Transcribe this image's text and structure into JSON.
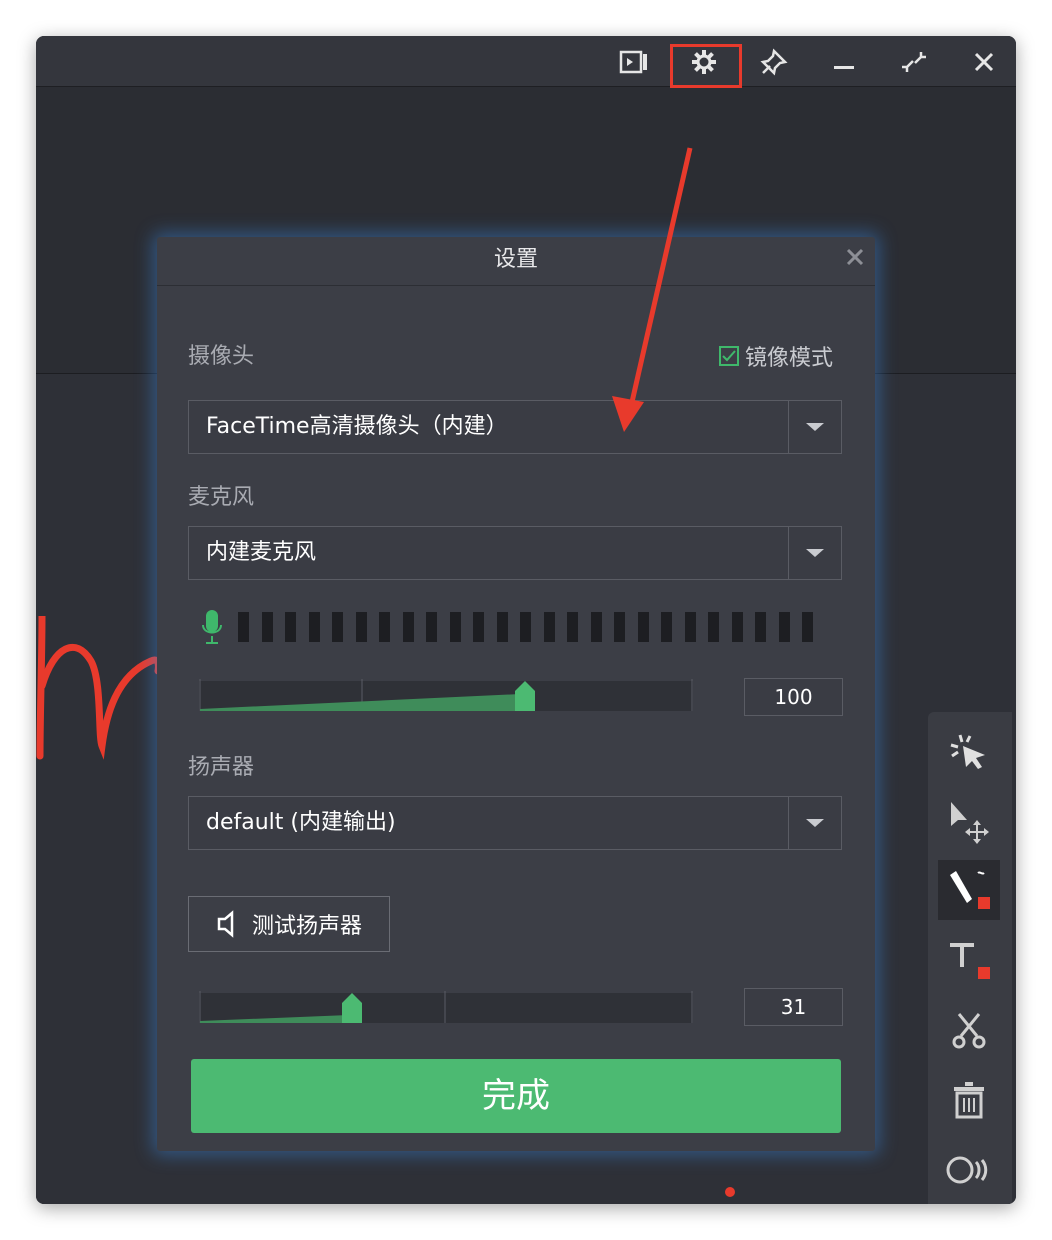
{
  "window": {
    "titlebar_icons": [
      "camera-toggle-icon",
      "gear-icon",
      "pin-icon",
      "minimize-icon",
      "shrink-icon",
      "close-icon"
    ]
  },
  "dialog": {
    "title": "设置",
    "camera": {
      "label": "摄像头",
      "mirror_label": "镜像模式",
      "mirror_checked": true,
      "selected": "FaceTime高清摄像头（内建）"
    },
    "microphone": {
      "label": "麦克风",
      "selected": "内建麦克风",
      "level_segments": 25,
      "volume_value": "100",
      "volume_fraction": 0.66
    },
    "speaker": {
      "label": "扬声器",
      "selected": "default (内建输出)",
      "test_button_label": "测试扬声器",
      "volume_value": "31",
      "volume_fraction": 0.31
    },
    "done_label": "完成"
  },
  "toolbar": {
    "tools": [
      "laser-pointer-icon",
      "move-select-icon",
      "pen-icon",
      "text-icon",
      "scissors-icon",
      "trash-icon",
      "spotlight-icon"
    ],
    "active_tool": "pen-icon",
    "accent_color": "#e83a2c"
  },
  "colors": {
    "accent_green": "#4cba72",
    "annotation_red": "#e83a2c"
  }
}
